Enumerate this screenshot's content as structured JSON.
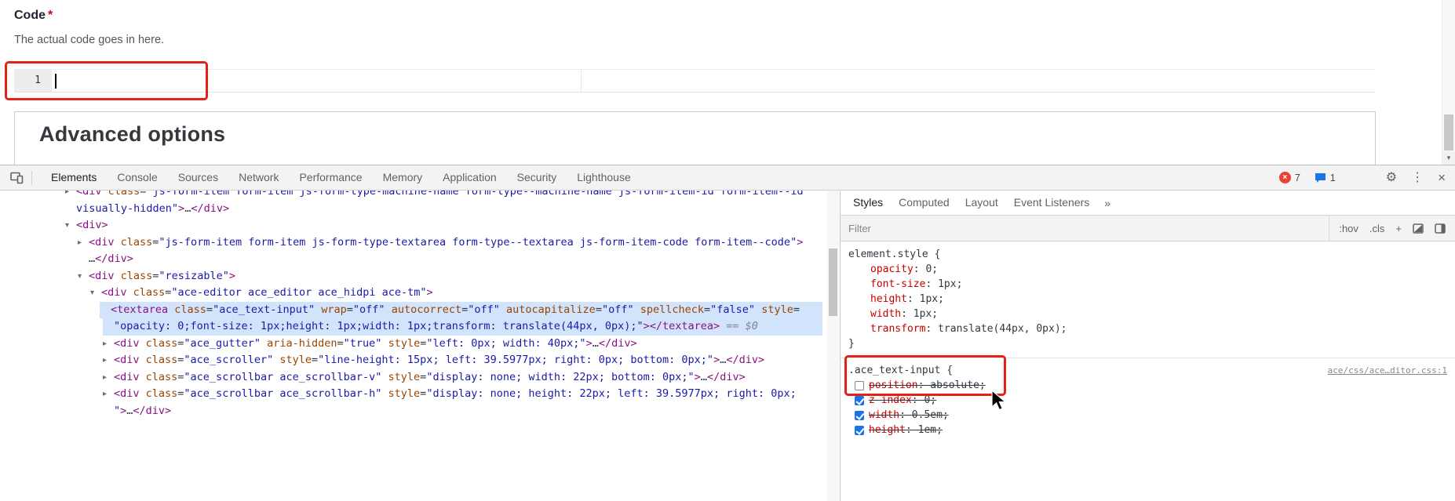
{
  "form": {
    "code_label": "Code",
    "required_marker": "*",
    "code_description": "The actual code goes in here.",
    "editor_line_number": "1",
    "advanced_options_title": "Advanced options"
  },
  "devtools": {
    "toolbar": {
      "tabs": [
        "Elements",
        "Console",
        "Sources",
        "Network",
        "Performance",
        "Memory",
        "Application",
        "Security",
        "Lighthouse"
      ],
      "selected_tab": "Elements",
      "error_count": "7",
      "message_count": "1"
    },
    "icons": {
      "error_x": "×",
      "gear": "⚙",
      "more": "⋮",
      "close": "×",
      "collapsed": "▸",
      "expanded": "▾",
      "scroll_down": "▾"
    },
    "dom_tree": {
      "lines": [
        {
          "indent": 97,
          "arrow": "right",
          "sel": false,
          "toks": [
            [
              "<div ",
              "g"
            ],
            [
              "class",
              "a"
            ],
            [
              "=",
              "p"
            ],
            [
              "\"js-form-item form-item js-form-type-machine-name form-type--machine-name js-form-item-id form-item--id",
              "v"
            ]
          ]
        },
        {
          "indent": 97,
          "arrow": "",
          "sel": false,
          "toks": [
            [
              "visually-hidden\"",
              "v"
            ],
            [
              ">",
              "g"
            ],
            [
              "…",
              "p"
            ],
            [
              "</div>",
              "g"
            ]
          ]
        },
        {
          "indent": 97,
          "arrow": "down",
          "sel": false,
          "toks": [
            [
              "<div>",
              "g"
            ]
          ]
        },
        {
          "indent": 113,
          "arrow": "right",
          "sel": false,
          "toks": [
            [
              "<div ",
              "g"
            ],
            [
              "class",
              "a"
            ],
            [
              "=",
              "p"
            ],
            [
              "\"js-form-item form-item js-form-type-textarea form-type--textarea js-form-item-code form-item--code\"",
              "v"
            ],
            [
              ">",
              "g"
            ]
          ]
        },
        {
          "indent": 113,
          "arrow": "",
          "sel": false,
          "toks": [
            [
              "…",
              "p"
            ],
            [
              "</div>",
              "g"
            ]
          ]
        },
        {
          "indent": 113,
          "arrow": "down",
          "sel": false,
          "toks": [
            [
              "<div ",
              "g"
            ],
            [
              "class",
              "a"
            ],
            [
              "=",
              "p"
            ],
            [
              "\"resizable\"",
              "v"
            ],
            [
              ">",
              "g"
            ]
          ]
        },
        {
          "indent": 129,
          "arrow": "down",
          "sel": false,
          "toks": [
            [
              "<div ",
              "g"
            ],
            [
              "class",
              "a"
            ],
            [
              "=",
              "p"
            ],
            [
              "\"ace-editor ace_editor ace_hidpi ace-tm\"",
              "v"
            ],
            [
              ">",
              "g"
            ]
          ]
        },
        {
          "indent": 141,
          "arrow": "",
          "sel": true,
          "toks": [
            [
              "<textarea ",
              "g"
            ],
            [
              "class",
              "a"
            ],
            [
              "=",
              "p"
            ],
            [
              "\"ace_text-input\"",
              "v"
            ],
            [
              " ",
              "p"
            ],
            [
              "wrap",
              "a"
            ],
            [
              "=",
              "p"
            ],
            [
              "\"off\"",
              "v"
            ],
            [
              " ",
              "p"
            ],
            [
              "autocorrect",
              "a"
            ],
            [
              "=",
              "p"
            ],
            [
              "\"off\"",
              "v"
            ],
            [
              " ",
              "p"
            ],
            [
              "autocapitalize",
              "a"
            ],
            [
              "=",
              "p"
            ],
            [
              "\"off\"",
              "v"
            ],
            [
              " ",
              "p"
            ],
            [
              "spellcheck",
              "a"
            ],
            [
              "=",
              "p"
            ],
            [
              "\"false\"",
              "v"
            ],
            [
              " ",
              "p"
            ],
            [
              "style",
              "a"
            ],
            [
              "=",
              "p"
            ]
          ]
        },
        {
          "indent": 145,
          "arrow": "",
          "sel": true,
          "toks": [
            [
              "\"opacity: 0;font-size: 1px;height: 1px;width: 1px;transform: translate(44px, 0px);\"",
              "v"
            ],
            [
              "></textarea>",
              "g"
            ],
            [
              " == $0",
              "d"
            ]
          ]
        },
        {
          "indent": 145,
          "arrow": "right",
          "sel": false,
          "toks": [
            [
              "<div ",
              "g"
            ],
            [
              "class",
              "a"
            ],
            [
              "=",
              "p"
            ],
            [
              "\"ace_gutter\"",
              "v"
            ],
            [
              " ",
              "p"
            ],
            [
              "aria-hidden",
              "a"
            ],
            [
              "=",
              "p"
            ],
            [
              "\"true\"",
              "v"
            ],
            [
              " ",
              "p"
            ],
            [
              "style",
              "a"
            ],
            [
              "=",
              "p"
            ],
            [
              "\"left: 0px; width: 40px;\"",
              "v"
            ],
            [
              ">",
              "g"
            ],
            [
              "…",
              "p"
            ],
            [
              "</div>",
              "g"
            ]
          ]
        },
        {
          "indent": 145,
          "arrow": "right",
          "sel": false,
          "toks": [
            [
              "<div ",
              "g"
            ],
            [
              "class",
              "a"
            ],
            [
              "=",
              "p"
            ],
            [
              "\"ace_scroller\"",
              "v"
            ],
            [
              " ",
              "p"
            ],
            [
              "style",
              "a"
            ],
            [
              "=",
              "p"
            ],
            [
              "\"line-height: 15px; left: 39.5977px; right: 0px; bottom: 0px;\"",
              "v"
            ],
            [
              ">",
              "g"
            ],
            [
              "…",
              "p"
            ],
            [
              "</div>",
              "g"
            ]
          ]
        },
        {
          "indent": 145,
          "arrow": "right",
          "sel": false,
          "toks": [
            [
              "<div ",
              "g"
            ],
            [
              "class",
              "a"
            ],
            [
              "=",
              "p"
            ],
            [
              "\"ace_scrollbar ace_scrollbar-v\"",
              "v"
            ],
            [
              " ",
              "p"
            ],
            [
              "style",
              "a"
            ],
            [
              "=",
              "p"
            ],
            [
              "\"display: none; width: 22px; bottom: 0px;\"",
              "v"
            ],
            [
              ">",
              "g"
            ],
            [
              "…",
              "p"
            ],
            [
              "</div>",
              "g"
            ]
          ]
        },
        {
          "indent": 145,
          "arrow": "right",
          "sel": false,
          "toks": [
            [
              "<div ",
              "g"
            ],
            [
              "class",
              "a"
            ],
            [
              "=",
              "p"
            ],
            [
              "\"ace_scrollbar ace_scrollbar-h\"",
              "v"
            ],
            [
              " ",
              "p"
            ],
            [
              "style",
              "a"
            ],
            [
              "=",
              "p"
            ],
            [
              "\"display: none; height: 22px; left: 39.5977px; right: 0px;",
              "v"
            ]
          ]
        },
        {
          "indent": 145,
          "arrow": "",
          "sel": false,
          "toks": [
            [
              "\"",
              "v"
            ],
            [
              ">",
              "g"
            ],
            [
              "…",
              "p"
            ],
            [
              "</div>",
              "g"
            ]
          ]
        }
      ]
    },
    "styles": {
      "tabs": [
        "Styles",
        "Computed",
        "Layout",
        "Event Listeners"
      ],
      "selected_tab": "Styles",
      "overflow_tab": "»",
      "filter_placeholder": "Filter",
      "pseudo_label": ":hov",
      "class_label": ".cls",
      "new_rule_label": "+",
      "punct": {
        "colon": ": ",
        "semi": ";",
        "open": " {",
        "close": "}"
      },
      "element_style": {
        "selector": "element.style",
        "properties": [
          {
            "name": "opacity",
            "value": "0"
          },
          {
            "name": "font-size",
            "value": "1px"
          },
          {
            "name": "height",
            "value": "1px"
          },
          {
            "name": "width",
            "value": "1px"
          },
          {
            "name": "transform",
            "value": "translate(44px, 0px)"
          }
        ]
      },
      "rule": {
        "selector": ".ace_text-input",
        "source_link": "ace/css/ace…ditor.css:1",
        "properties": [
          {
            "name": "position",
            "value": "absolute",
            "checked": false,
            "struck": true
          },
          {
            "name": "z-index",
            "value": "0",
            "checked": true,
            "struck": true
          },
          {
            "name": "width",
            "value": "0.5em",
            "checked": true,
            "struck": true
          },
          {
            "name": "height",
            "value": "1em",
            "checked": true,
            "struck": true
          }
        ]
      }
    }
  },
  "colors": {
    "annotation": "#e32119",
    "accent_blue": "#1a73e8",
    "error_red": "#e94235",
    "selection_blue": "#d2e4fc"
  }
}
